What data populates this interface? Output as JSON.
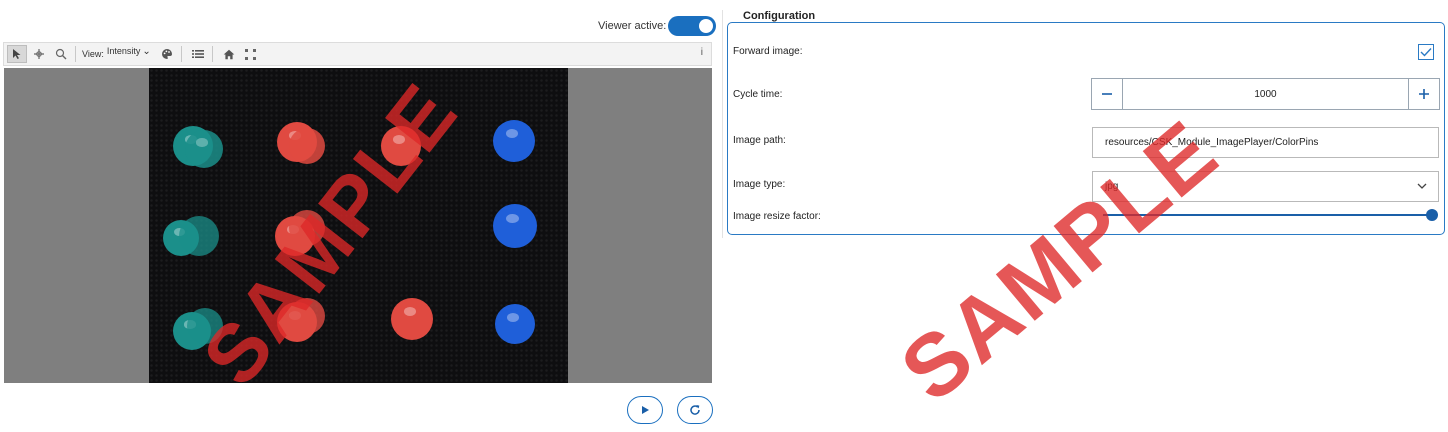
{
  "viewer": {
    "active_label": "Viewer active:",
    "active": true,
    "toolbar": {
      "view_label": "View:",
      "view_value": "Intensity",
      "info_label": "i",
      "icons": [
        "pointer-icon",
        "pan-icon",
        "zoom-icon",
        "palette-icon",
        "list-icon",
        "home-icon",
        "fit-icon"
      ]
    },
    "watermark": "SAMPLE",
    "pin_colors": {
      "teal": "#1b8f8a",
      "red": "#e04a41",
      "blue": "#1f5fd9"
    }
  },
  "controls": {
    "play_icon": "play-icon",
    "refresh_icon": "refresh-icon"
  },
  "configuration": {
    "title": "Configuration",
    "forward_image_label": "Forward image:",
    "forward_image_checked": true,
    "cycle_time_label": "Cycle time:",
    "cycle_time_value": "1000",
    "image_path_label": "Image path:",
    "image_path_value": "resources/CSK_Module_ImagePlayer/ColorPins",
    "image_type_label": "Image type:",
    "image_type_value": "jpg",
    "image_resize_label": "Image resize factor:",
    "image_resize_fraction": 1.0,
    "watermark": "SAMPLE"
  },
  "colors": {
    "accent": "#1a6fbf",
    "watermark": "#de2828"
  }
}
